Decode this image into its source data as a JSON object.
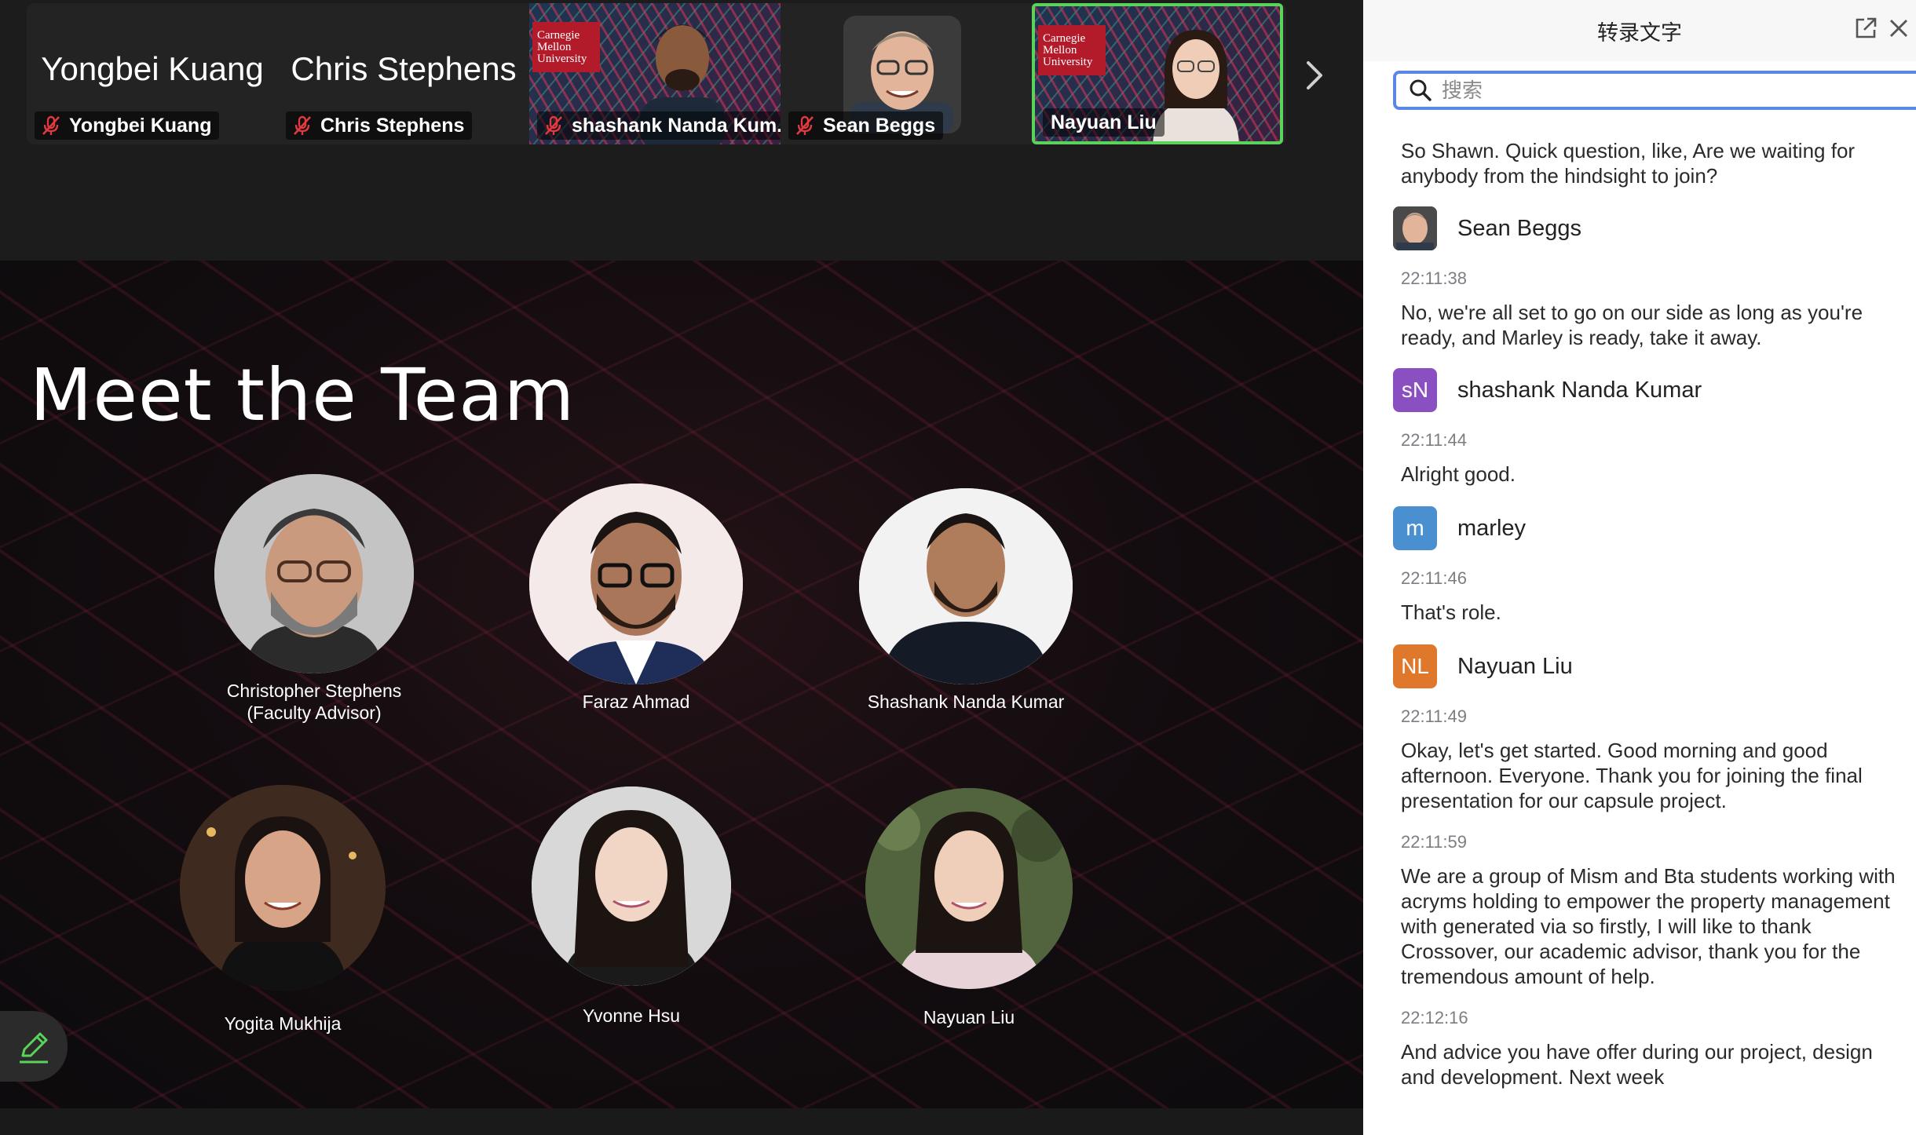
{
  "participants": [
    {
      "display_name": "Yongbei Kuang",
      "label": "Yongbei Kuang",
      "muted": true,
      "video": false
    },
    {
      "display_name": "Chris Stephens",
      "label": "Chris Stephens",
      "muted": true,
      "video": false
    },
    {
      "label": "shashank Nanda Kum...",
      "muted": true,
      "video": true,
      "logo_text": "Carnegie Mellon University"
    },
    {
      "label": "Sean Beggs",
      "muted": true,
      "video": true
    },
    {
      "label": "Nayuan Liu",
      "muted": false,
      "video": true,
      "active_speaker": true,
      "logo_text": "Carnegie Mellon University"
    }
  ],
  "slide": {
    "title": "Meet the Team",
    "members": [
      {
        "name_line1": "Christopher Stephens",
        "name_line2": "(Faculty Advisor)"
      },
      {
        "name_line1": "Faraz Ahmad",
        "name_line2": ""
      },
      {
        "name_line1": "Shashank Nanda Kumar",
        "name_line2": ""
      },
      {
        "name_line1": "Yogita Mukhija",
        "name_line2": ""
      },
      {
        "name_line1": "Yvonne Hsu",
        "name_line2": ""
      },
      {
        "name_line1": "Nayuan Liu",
        "name_line2": ""
      }
    ]
  },
  "panel": {
    "title": "转录文字",
    "search_placeholder": "搜索",
    "entries": [
      {
        "type": "text",
        "text": "So Shawn. Quick question, like, Are we waiting for anybody from the hindsight to join?"
      },
      {
        "type": "speaker",
        "name": "Sean Beggs",
        "avatar": "photo"
      },
      {
        "type": "time",
        "text": "22:11:38"
      },
      {
        "type": "text",
        "text": "No, we're all set to go on our side as long as you're ready, and Marley is ready, take it away."
      },
      {
        "type": "speaker",
        "name": "shashank Nanda Kumar",
        "initials": "sN",
        "color": "#8a4fc1"
      },
      {
        "type": "time",
        "text": "22:11:44"
      },
      {
        "type": "text",
        "text": "Alright good."
      },
      {
        "type": "speaker",
        "name": "marley",
        "initials": "m",
        "color": "#4a8fcf"
      },
      {
        "type": "time",
        "text": "22:11:46"
      },
      {
        "type": "text",
        "text": "That's role."
      },
      {
        "type": "speaker",
        "name": "Nayuan Liu",
        "initials": "NL",
        "color": "#e0782c"
      },
      {
        "type": "time",
        "text": "22:11:49"
      },
      {
        "type": "text",
        "text": "Okay, let's get started. Good morning and good afternoon. Everyone. Thank you for joining the final presentation for our capsule project."
      },
      {
        "type": "time",
        "text": "22:11:59"
      },
      {
        "type": "text",
        "text": "We are a group of Mism and Bta students working with acryms holding to empower the property management with generated via so firstly, I will like to thank Crossover, our academic advisor, thank you for the tremendous amount of help."
      },
      {
        "type": "time",
        "text": "22:12:16"
      },
      {
        "type": "text",
        "text": "And advice you have offer during our project, design and development. Next week"
      }
    ]
  },
  "colors": {
    "accent_green": "#5ad35a",
    "mute_red": "#e0393e",
    "search_border": "#5a86e6",
    "cmu_red": "#b31b2a"
  }
}
